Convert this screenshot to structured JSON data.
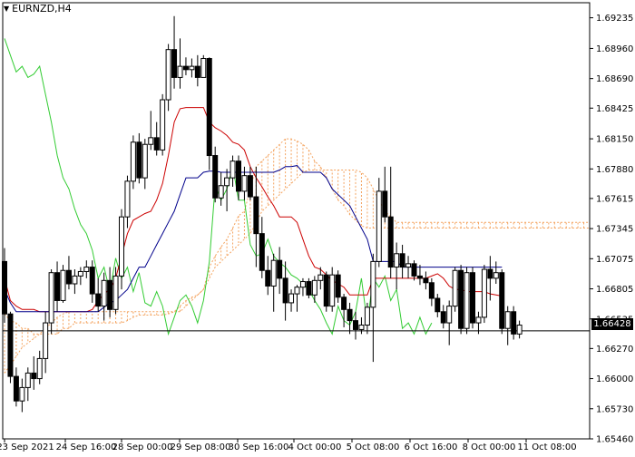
{
  "window": {
    "symbol_label": "EURNZD,H4",
    "menu_icon": "triangle-down-icon"
  },
  "colors": {
    "background": "#ffffff",
    "axis": "#000000",
    "candle": "#000000",
    "kijun": "#cc0000",
    "tenkan": "#00008b",
    "chikou": "#33cc33",
    "cloud": "#f4a460",
    "price_line": "#000000",
    "price_tag_bg": "#000000",
    "price_tag_fg": "#ffffff"
  },
  "chart_data": {
    "type": "candlestick",
    "title": "EURNZD,H4",
    "y_ticks": [
      "1.69235",
      "1.68960",
      "1.68690",
      "1.68425",
      "1.68150",
      "1.67880",
      "1.67615",
      "1.67345",
      "1.67075",
      "1.66805",
      "1.66535",
      "1.66270",
      "1.66000",
      "1.65730",
      "1.65460"
    ],
    "x_ticks": [
      "23 Sep 2021",
      "24 Sep 16:00",
      "28 Sep 00:00",
      "29 Sep 08:00",
      "30 Sep 16:00",
      "4 Oct 00:00",
      "5 Oct 08:00",
      "6 Oct 16:00",
      "8 Oct 00:00",
      "11 Oct 08:00"
    ],
    "current_price": "1.66428",
    "ylim": [
      1.6546,
      1.6937
    ],
    "candles": [
      [
        1.6705,
        1.6717,
        1.665,
        1.6658
      ],
      [
        1.6658,
        1.666,
        1.6596,
        1.6602
      ],
      [
        1.6602,
        1.661,
        1.6575,
        1.658
      ],
      [
        1.658,
        1.66,
        1.657,
        1.6592
      ],
      [
        1.6592,
        1.661,
        1.658,
        1.6605
      ],
      [
        1.6605,
        1.662,
        1.659,
        1.66
      ],
      [
        1.66,
        1.6625,
        1.6595,
        1.6618
      ],
      [
        1.6618,
        1.666,
        1.6605,
        1.665
      ],
      [
        1.665,
        1.6698,
        1.664,
        1.6695
      ],
      [
        1.6695,
        1.6705,
        1.666,
        1.667
      ],
      [
        1.667,
        1.6702,
        1.6668,
        1.6697
      ],
      [
        1.6697,
        1.671,
        1.668,
        1.6685
      ],
      [
        1.6685,
        1.6698,
        1.6676,
        1.6692
      ],
      [
        1.6692,
        1.67,
        1.6684,
        1.6696
      ],
      [
        1.6696,
        1.6706,
        1.669,
        1.67
      ],
      [
        1.67,
        1.6706,
        1.6668,
        1.6676
      ],
      [
        1.6676,
        1.669,
        1.666,
        1.6665
      ],
      [
        1.6665,
        1.6695,
        1.6652,
        1.6688
      ],
      [
        1.6688,
        1.67,
        1.6655,
        1.6662
      ],
      [
        1.6662,
        1.67,
        1.6658,
        1.6692
      ],
      [
        1.6692,
        1.6752,
        1.668,
        1.6745
      ],
      [
        1.6745,
        1.6782,
        1.6735,
        1.6777
      ],
      [
        1.6777,
        1.6818,
        1.677,
        1.6812
      ],
      [
        1.6812,
        1.682,
        1.6775,
        1.678
      ],
      [
        1.678,
        1.6815,
        1.677,
        1.681
      ],
      [
        1.681,
        1.684,
        1.6805,
        1.6816
      ],
      [
        1.6816,
        1.683,
        1.68,
        1.6805
      ],
      [
        1.6805,
        1.6855,
        1.68,
        1.685
      ],
      [
        1.685,
        1.69,
        1.684,
        1.6895
      ],
      [
        1.6895,
        1.6925,
        1.686,
        1.687
      ],
      [
        1.687,
        1.6905,
        1.686,
        1.688
      ],
      [
        1.688,
        1.6888,
        1.6872,
        1.6877
      ],
      [
        1.6877,
        1.6887,
        1.687,
        1.688
      ],
      [
        1.688,
        1.689,
        1.6862,
        1.687
      ],
      [
        1.687,
        1.689,
        1.687,
        1.6887
      ],
      [
        1.6887,
        1.6888,
        1.6787,
        1.68
      ],
      [
        1.68,
        1.6808,
        1.6758,
        1.6762
      ],
      [
        1.6762,
        1.6785,
        1.6755,
        1.6773
      ],
      [
        1.6773,
        1.6788,
        1.675,
        1.678
      ],
      [
        1.678,
        1.68,
        1.6772,
        1.6795
      ],
      [
        1.6795,
        1.68,
        1.676,
        1.6768
      ],
      [
        1.6768,
        1.679,
        1.676,
        1.6782
      ],
      [
        1.6782,
        1.679,
        1.676,
        1.6763
      ],
      [
        1.6763,
        1.679,
        1.67,
        1.673
      ],
      [
        1.673,
        1.6745,
        1.669,
        1.6697
      ],
      [
        1.6697,
        1.671,
        1.6675,
        1.6683
      ],
      [
        1.6683,
        1.6712,
        1.666,
        1.6706
      ],
      [
        1.6706,
        1.6718,
        1.6676,
        1.669
      ],
      [
        1.669,
        1.6705,
        1.6652,
        1.6668
      ],
      [
        1.6668,
        1.668,
        1.666,
        1.6676
      ],
      [
        1.6676,
        1.6684,
        1.666,
        1.6682
      ],
      [
        1.6682,
        1.669,
        1.6674,
        1.6687
      ],
      [
        1.6687,
        1.669,
        1.6672,
        1.6675
      ],
      [
        1.6675,
        1.6692,
        1.6668,
        1.6688
      ],
      [
        1.6688,
        1.67,
        1.668,
        1.6693
      ],
      [
        1.6693,
        1.6696,
        1.666,
        1.6665
      ],
      [
        1.6665,
        1.67,
        1.666,
        1.6693
      ],
      [
        1.6693,
        1.6697,
        1.6668,
        1.6673
      ],
      [
        1.6673,
        1.6676,
        1.6646,
        1.6662
      ],
      [
        1.6662,
        1.6668,
        1.664,
        1.6652
      ],
      [
        1.6652,
        1.666,
        1.6635,
        1.6644
      ],
      [
        1.6644,
        1.6655,
        1.664,
        1.6648
      ],
      [
        1.6648,
        1.6668,
        1.664,
        1.6664
      ],
      [
        1.6664,
        1.6712,
        1.6615,
        1.6705
      ],
      [
        1.6705,
        1.678,
        1.67,
        1.6768
      ],
      [
        1.6768,
        1.679,
        1.674,
        1.6745
      ],
      [
        1.6745,
        1.679,
        1.669,
        1.67
      ],
      [
        1.67,
        1.6722,
        1.668,
        1.6712
      ],
      [
        1.6712,
        1.672,
        1.669,
        1.67
      ],
      [
        1.67,
        1.671,
        1.669,
        1.6703
      ],
      [
        1.6703,
        1.6706,
        1.6688,
        1.6692
      ],
      [
        1.6692,
        1.6702,
        1.6684,
        1.669
      ],
      [
        1.669,
        1.6696,
        1.668,
        1.6686
      ],
      [
        1.6686,
        1.669,
        1.6665,
        1.6672
      ],
      [
        1.6672,
        1.6676,
        1.6655,
        1.666
      ],
      [
        1.666,
        1.6666,
        1.6645,
        1.665
      ],
      [
        1.665,
        1.667,
        1.663,
        1.6665
      ],
      [
        1.6665,
        1.67,
        1.666,
        1.6697
      ],
      [
        1.6697,
        1.6702,
        1.664,
        1.6645
      ],
      [
        1.6645,
        1.67,
        1.664,
        1.6695
      ],
      [
        1.6695,
        1.67,
        1.6645,
        1.665
      ],
      [
        1.665,
        1.666,
        1.664,
        1.6655
      ],
      [
        1.6655,
        1.6702,
        1.665,
        1.6698
      ],
      [
        1.6698,
        1.671,
        1.667,
        1.669
      ],
      [
        1.669,
        1.6705,
        1.6685,
        1.6695
      ],
      [
        1.6695,
        1.6698,
        1.664,
        1.6645
      ],
      [
        1.6645,
        1.6665,
        1.663,
        1.666
      ],
      [
        1.666,
        1.6665,
        1.6635,
        1.664
      ],
      [
        1.664,
        1.6652,
        1.6636,
        1.6648
      ]
    ],
    "tenkan": [
      1.668,
      1.6668,
      1.666,
      1.666,
      1.666,
      1.666,
      1.666,
      1.666,
      1.666,
      1.666,
      1.666,
      1.666,
      1.666,
      1.666,
      1.666,
      1.666,
      1.666,
      1.6664,
      1.6668,
      1.667,
      1.6675,
      1.668,
      1.669,
      1.67,
      1.67,
      1.671,
      1.672,
      1.673,
      1.674,
      1.675,
      1.6765,
      1.678,
      1.678,
      1.678,
      1.6785,
      1.6786,
      1.6786,
      1.6785,
      1.6785,
      1.6785,
      1.6785,
      1.6785,
      1.6785,
      1.6785,
      1.6785,
      1.6785,
      1.6785,
      1.6787,
      1.679,
      1.679,
      1.6791,
      1.6785,
      1.6785,
      1.6785,
      1.6785,
      1.678,
      1.677,
      1.6765,
      1.676,
      1.6755,
      1.6745,
      1.6735,
      1.6725,
      1.6705,
      1.6705,
      1.6705,
      1.6705,
      1.6705,
      1.67,
      1.67,
      1.67,
      1.67,
      1.67,
      1.67,
      1.67,
      1.67,
      1.67,
      1.67,
      1.67,
      1.67,
      1.67,
      1.67,
      1.67,
      1.67,
      1.67,
      1.67
    ],
    "kijun": [
      1.669,
      1.667,
      1.6665,
      1.6662,
      1.6662,
      1.6662,
      1.666,
      1.666,
      1.666,
      1.666,
      1.666,
      1.666,
      1.666,
      1.666,
      1.666,
      1.6662,
      1.667,
      1.6676,
      1.668,
      1.669,
      1.671,
      1.673,
      1.6742,
      1.6745,
      1.6748,
      1.675,
      1.676,
      1.6775,
      1.68,
      1.683,
      1.6842,
      1.6843,
      1.6843,
      1.6843,
      1.6843,
      1.683,
      1.6825,
      1.6822,
      1.6818,
      1.6812,
      1.681,
      1.6805,
      1.679,
      1.678,
      1.6772,
      1.6763,
      1.6755,
      1.6745,
      1.6745,
      1.6745,
      1.674,
      1.6725,
      1.671,
      1.67,
      1.6698,
      1.6693,
      1.6688,
      1.6685,
      1.6682,
      1.6675,
      1.6675,
      1.6675,
      1.6675,
      1.669,
      1.669,
      1.669,
      1.669,
      1.669,
      1.669,
      1.669,
      1.669,
      1.669,
      1.669,
      1.6692,
      1.6694,
      1.669,
      1.6683,
      1.668,
      1.668,
      1.6678,
      1.6678,
      1.6678,
      1.6678,
      1.6676,
      1.6675,
      1.6674
    ],
    "chikou": [
      1.6905,
      1.689,
      1.6875,
      1.688,
      1.687,
      1.6873,
      1.688,
      1.6855,
      1.683,
      1.68,
      1.678,
      1.677,
      1.6752,
      1.6738,
      1.673,
      1.6715,
      1.669,
      1.67,
      1.6678,
      1.6708,
      1.669,
      1.67,
      1.6678,
      1.6695,
      1.6668,
      1.6665,
      1.6678,
      1.6665,
      1.664,
      1.6655,
      1.667,
      1.6675,
      1.6665,
      1.665,
      1.667,
      1.6705,
      1.6773,
      1.676,
      1.677,
      1.679,
      1.676,
      1.676,
      1.672,
      1.671,
      1.6712,
      1.6725,
      1.671,
      1.6704,
      1.67,
      1.6693,
      1.669,
      1.6685,
      1.668,
      1.667,
      1.6662,
      1.665,
      1.664,
      1.6665,
      1.6652,
      1.6648,
      1.666,
      1.669,
      1.665,
      1.669,
      1.6682,
      1.6692,
      1.667,
      1.668,
      1.6645,
      1.665,
      1.664,
      1.6655,
      1.664,
      1.665
    ],
    "cloud_span_a": [
      1.6658,
      1.6652,
      1.665,
      1.6645,
      1.6645,
      1.664,
      1.664,
      1.664,
      1.664,
      1.664,
      1.6645,
      1.6645,
      1.665,
      1.665,
      1.665,
      1.665,
      1.665,
      1.665,
      1.665,
      1.665,
      1.665,
      1.6652,
      1.6655,
      1.6657,
      1.6657,
      1.6657,
      1.6657,
      1.6657,
      1.6658,
      1.666,
      1.6665,
      1.667,
      1.6673,
      1.6675,
      1.668,
      1.67,
      1.671,
      1.6718,
      1.6725,
      1.6735,
      1.6746,
      1.675,
      1.677,
      1.679,
      1.6795,
      1.68,
      1.6805,
      1.681,
      1.6815,
      1.6815,
      1.6813,
      1.681,
      1.6805,
      1.6795,
      1.679,
      1.678,
      1.677,
      1.676,
      1.6755,
      1.6747,
      1.6742,
      1.6737,
      1.6735,
      1.6735,
      1.6735,
      1.6735,
      1.6735,
      1.6735,
      1.6735,
      1.6735,
      1.6735,
      1.6735,
      1.6735,
      1.6735,
      1.6735,
      1.6735,
      1.6735,
      1.6735,
      1.6735,
      1.6735,
      1.6735,
      1.6735,
      1.6735,
      1.6735,
      1.6735,
      1.6735,
      1.6735,
      1.6735,
      1.6735,
      1.6735,
      1.6735,
      1.6735,
      1.6735,
      1.6735,
      1.6735,
      1.6735,
      1.6735,
      1.6735,
      1.6735,
      1.6735,
      1.6735,
      1.6735,
      1.6735,
      1.6735,
      1.6735,
      1.6735,
      1.6735,
      1.6735,
      1.6735,
      1.6735,
      1.6735,
      1.6735,
      1.6735,
      1.6735
    ],
    "cloud_span_b": [
      1.6605,
      1.6612,
      1.662,
      1.6628,
      1.6632,
      1.6636,
      1.664,
      1.6645,
      1.665,
      1.6655,
      1.6658,
      1.666,
      1.666,
      1.666,
      1.666,
      1.666,
      1.666,
      1.666,
      1.666,
      1.666,
      1.666,
      1.666,
      1.666,
      1.666,
      1.666,
      1.666,
      1.666,
      1.666,
      1.666,
      1.666,
      1.666,
      1.6665,
      1.667,
      1.6675,
      1.668,
      1.669,
      1.67,
      1.6705,
      1.671,
      1.6715,
      1.672,
      1.6725,
      1.673,
      1.674,
      1.675,
      1.6755,
      1.676,
      1.6765,
      1.677,
      1.6775,
      1.678,
      1.6785,
      1.6787,
      1.6787,
      1.6787,
      1.6787,
      1.6787,
      1.6787,
      1.6787,
      1.6787,
      1.6787,
      1.6785,
      1.678,
      1.677,
      1.676,
      1.675,
      1.6745,
      1.674,
      1.674,
      1.674,
      1.674,
      1.674,
      1.674,
      1.674,
      1.674,
      1.674,
      1.674,
      1.674,
      1.674,
      1.674,
      1.674,
      1.674,
      1.674,
      1.674,
      1.674,
      1.674,
      1.674,
      1.674,
      1.674,
      1.674,
      1.674,
      1.674,
      1.674,
      1.674,
      1.674,
      1.674,
      1.674,
      1.674,
      1.674,
      1.674,
      1.674,
      1.674,
      1.674,
      1.674,
      1.674,
      1.674,
      1.674,
      1.674,
      1.674,
      1.674,
      1.674,
      1.674,
      1.674,
      1.674
    ]
  }
}
